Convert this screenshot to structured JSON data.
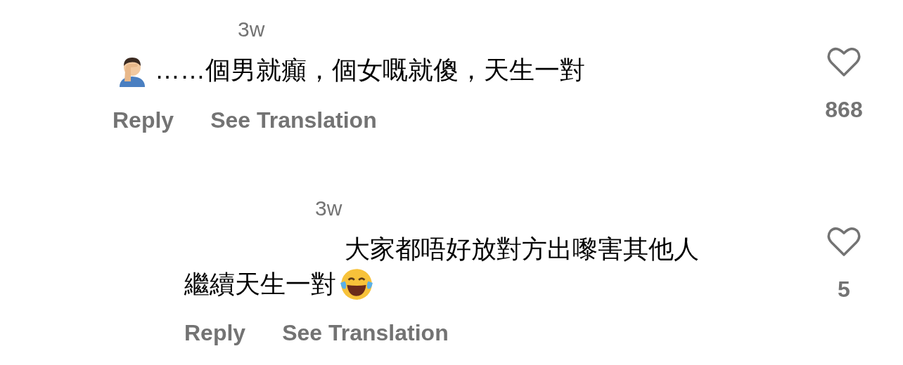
{
  "comments": [
    {
      "kind": "comment",
      "time": "3w",
      "lines": [
        [
          {
            "kind": "facepalm"
          },
          {
            "kind": "text",
            "text": "……個男就癲，個女嘅就傻，天生一對"
          }
        ]
      ],
      "actions": [
        "Reply",
        "See Translation"
      ],
      "liked": false,
      "likes": "868"
    },
    {
      "kind": "reply",
      "time": "3w",
      "lines": [
        [
          {
            "kind": "text",
            "text": "大家都唔好放對方出嚟害其他人"
          }
        ],
        [
          {
            "kind": "text",
            "text": "繼續天生一對"
          },
          {
            "kind": "laughing"
          }
        ]
      ],
      "actions": [
        "Reply",
        "See Translation"
      ],
      "liked": false,
      "likes": "5"
    }
  ]
}
